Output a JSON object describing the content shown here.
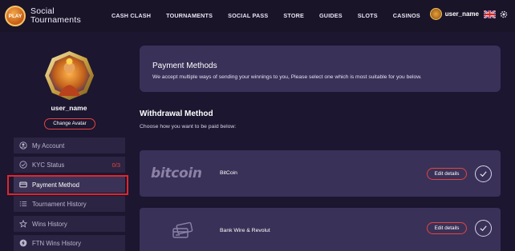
{
  "header": {
    "logo_badge": "PLAY",
    "logo_line1": "Social",
    "logo_line2": "Tournaments",
    "nav": [
      "CASH CLASH",
      "TOURNAMENTS",
      "SOCIAL PASS",
      "STORE",
      "GUIDES",
      "SLOTS",
      "CASINOS"
    ],
    "username": "user_name"
  },
  "sidebar": {
    "username": "user_name",
    "change_avatar": "Change Avatar",
    "items": [
      {
        "label": "My Account",
        "icon": "user-icon"
      },
      {
        "label": "KYC Status",
        "icon": "kyc-icon",
        "count": "0/3"
      },
      {
        "label": "Payment Method",
        "icon": "card-icon",
        "active": true
      },
      {
        "label": "Tournament History",
        "icon": "list-icon"
      },
      {
        "label": "Wins History",
        "icon": "star-icon"
      },
      {
        "label": "FTN Wins History",
        "icon": "lightning-icon"
      }
    ]
  },
  "main": {
    "info_title": "Payment Methods",
    "info_desc": "We accept multiple ways of sending your winnings to you, Please select one which is most suitable for you below.",
    "withdrawal_title": "Withdrawal Method",
    "withdrawal_sub": "Choose how you want to be paid below:",
    "methods": [
      {
        "logo_text": "bitcoin",
        "name": "BitCoin",
        "edit": "Edit details"
      },
      {
        "logo_icon": "bank-cards-icon",
        "name": "Bank Wire & Revolut",
        "edit": "Edit details"
      }
    ]
  },
  "colors": {
    "background": "#1c1630",
    "card": "#3a3158",
    "sidebar_item": "#2b2442",
    "accent_red": "#e3453f",
    "highlight_outline": "#e0262b"
  }
}
